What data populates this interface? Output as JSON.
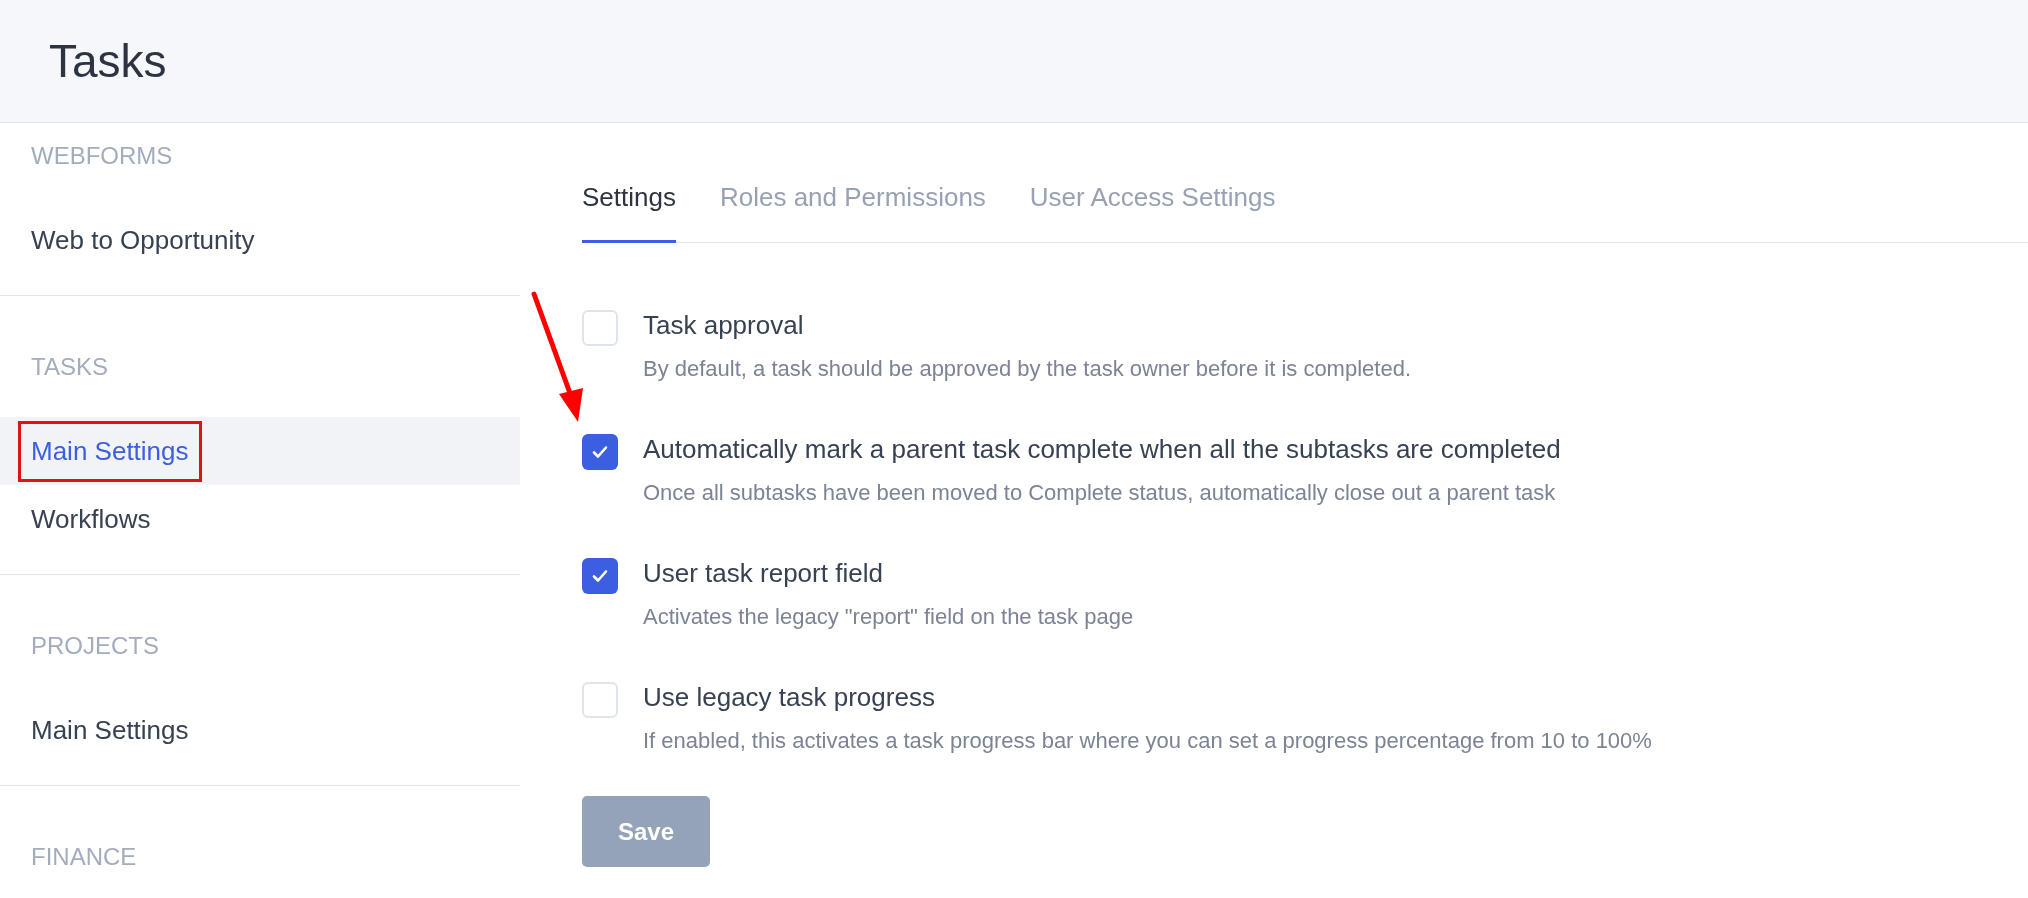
{
  "header": {
    "title": "Tasks"
  },
  "sidebar": {
    "sections": [
      {
        "label": "WEBFORMS",
        "items": [
          {
            "label": "Web to Opportunity",
            "selected": false
          }
        ]
      },
      {
        "label": "TASKS",
        "items": [
          {
            "label": "Main Settings",
            "selected": true
          },
          {
            "label": "Workflows",
            "selected": false
          }
        ]
      },
      {
        "label": "PROJECTS",
        "items": [
          {
            "label": "Main Settings",
            "selected": false
          }
        ]
      },
      {
        "label": "FINANCE"
      }
    ]
  },
  "tabs": [
    {
      "label": "Settings",
      "selected": true
    },
    {
      "label": "Roles and Permissions",
      "selected": false
    },
    {
      "label": "User Access Settings",
      "selected": false
    }
  ],
  "settings": [
    {
      "title": "Task approval",
      "description": "By default, a task should be approved by the task owner before it is completed.",
      "checked": false
    },
    {
      "title": "Automatically mark a parent task complete when all the subtasks are completed",
      "description": "Once all subtasks have been moved to Complete status, automatically close out a parent task",
      "checked": true
    },
    {
      "title": "User task report field",
      "description": "Activates the legacy \"report\" field on the task page",
      "checked": true
    },
    {
      "title": "Use legacy task progress",
      "description": "If enabled, this activates a task progress bar where you can set a progress percentage from 10 to 100%",
      "checked": false
    }
  ],
  "save_button": {
    "label": "Save"
  }
}
